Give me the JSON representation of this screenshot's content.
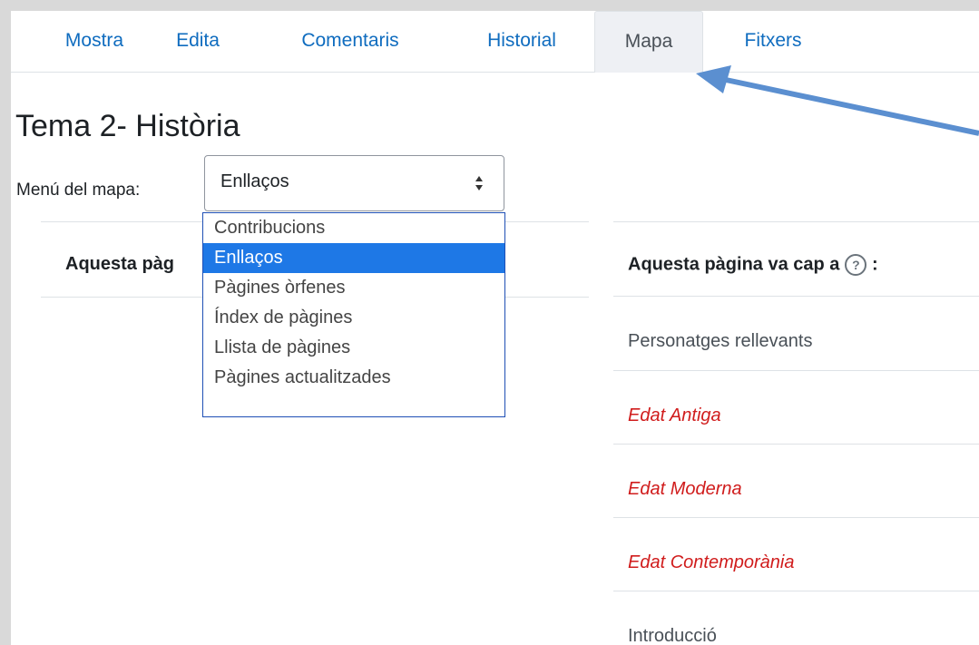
{
  "tabs": [
    "Mostra",
    "Edita",
    "Comentaris",
    "Historial",
    "Mapa",
    "Fitxers"
  ],
  "active_tab": "Mapa",
  "page_title": "Tema 2- Història",
  "map_menu": {
    "label": "Menú del mapa:",
    "selected": "Enllaços",
    "options": [
      "Contribucions",
      "Enllaços",
      "Pàgines òrfenes",
      "Índex de pàgines",
      "Llista de pàgines",
      "Pàgines actualitzades"
    ]
  },
  "left_column": {
    "header": "Aquesta pàg"
  },
  "right_column": {
    "header": "Aquesta pàgina va cap a",
    "header_suffix": ":",
    "help_icon": "question-circle-icon",
    "links": [
      {
        "text": "Personatges rellevants",
        "exists": true
      },
      {
        "text": "Edat Antiga",
        "exists": false
      },
      {
        "text": "Edat Moderna",
        "exists": false
      },
      {
        "text": "Edat Contemporània",
        "exists": false
      },
      {
        "text": "Introducció",
        "exists": true
      }
    ]
  },
  "colors": {
    "tab_link": "#0f6cbf",
    "missing_link": "#d01c1c",
    "selected_option": "#1e78e6",
    "annotation_arrow": "#5b8fd0"
  }
}
